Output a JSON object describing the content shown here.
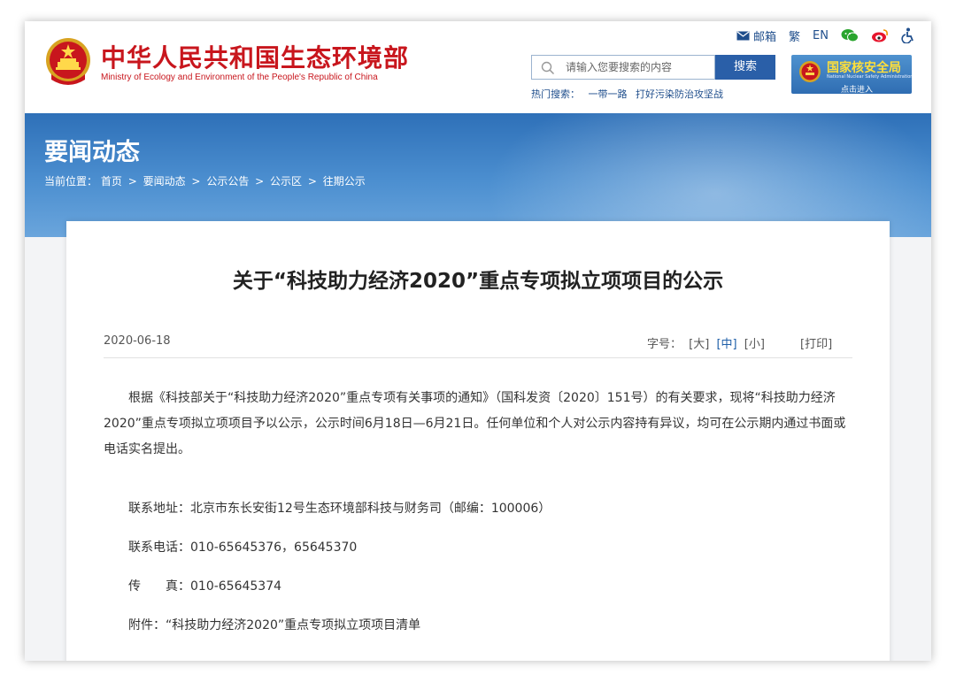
{
  "header": {
    "logo_cn": "中华人民共和国生态环境部",
    "logo_en": "Ministry of Ecology and Environment of the People's Republic of China",
    "top_links": {
      "mail": "邮箱",
      "traditional": "繁",
      "english": "EN"
    },
    "search": {
      "placeholder": "请输入您要搜索的内容",
      "button": "搜索"
    },
    "hot_search": {
      "label": "热门搜索：",
      "items": [
        "一带一路",
        "打好污染防治攻坚战"
      ]
    },
    "nsa_link": {
      "name": "国家核安全局",
      "english": "National Nuclear Safety Administration",
      "enter": "点击进入"
    }
  },
  "banner": {
    "title": "要闻动态",
    "breadcrumb_label": "当前位置：",
    "breadcrumb": [
      "首页",
      "要闻动态",
      "公示公告",
      "公示区",
      "往期公示"
    ],
    "separator": ">"
  },
  "article": {
    "title": "关于“科技助力经济2020”重点专项拟立项项目的公示",
    "date": "2020-06-18",
    "font_size_label": "字号：",
    "sizes": [
      "[大]",
      "[中]",
      "[小]"
    ],
    "active_size": "[中]",
    "print": "[打印]",
    "paragraph": "根据《科技部关于“科技助力经济2020”重点专项有关事项的通知》（国科发资〔2020〕151号）的有关要求，现将“科技助力经济2020”重点专项拟立项项目予以公示，公示时间6月18日—6月21日。任何单位和个人对公示内容持有异议，均可在公示期内通过书面或电话实名提出。",
    "address": "联系地址：北京市东长安街12号生态环境部科技与财务司（邮编：100006）",
    "phone": "联系电话：010-65645376，65645370",
    "fax": "传　　真：010-65645374",
    "attachment": "附件：“科技助力经济2020”重点专项拟立项项目清单"
  },
  "colors": {
    "brand_red": "#c8161d",
    "nav_blue": "#2a5fa8",
    "banner_blue": "#2e70b8"
  }
}
